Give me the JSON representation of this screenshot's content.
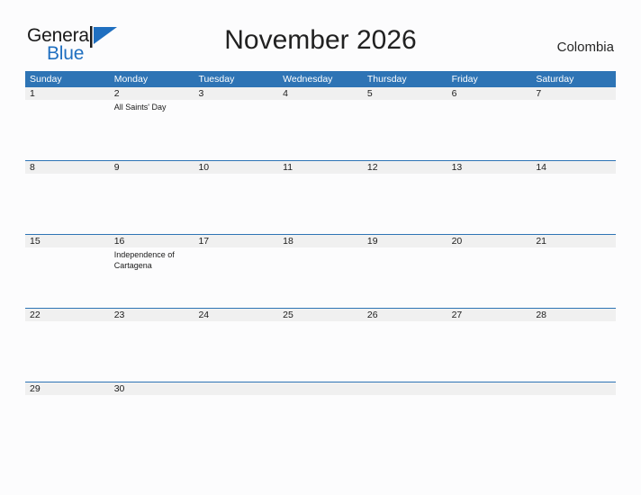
{
  "brand": {
    "name_part1": "General",
    "name_part2": "Blue",
    "flag_icon": "flag-triangle-icon",
    "blue": "#1f6fc0"
  },
  "header": {
    "title": "November 2026",
    "country": "Colombia"
  },
  "calendar": {
    "accent_color": "#2e74b5",
    "band_color": "#f0f0f0",
    "weekday_headers": [
      "Sunday",
      "Monday",
      "Tuesday",
      "Wednesday",
      "Thursday",
      "Friday",
      "Saturday"
    ],
    "weeks": [
      {
        "days": [
          {
            "date": "1",
            "events": []
          },
          {
            "date": "2",
            "events": [
              "All Saints' Day"
            ]
          },
          {
            "date": "3",
            "events": []
          },
          {
            "date": "4",
            "events": []
          },
          {
            "date": "5",
            "events": []
          },
          {
            "date": "6",
            "events": []
          },
          {
            "date": "7",
            "events": []
          }
        ]
      },
      {
        "days": [
          {
            "date": "8",
            "events": []
          },
          {
            "date": "9",
            "events": []
          },
          {
            "date": "10",
            "events": []
          },
          {
            "date": "11",
            "events": []
          },
          {
            "date": "12",
            "events": []
          },
          {
            "date": "13",
            "events": []
          },
          {
            "date": "14",
            "events": []
          }
        ]
      },
      {
        "days": [
          {
            "date": "15",
            "events": []
          },
          {
            "date": "16",
            "events": [
              "Independence of Cartagena"
            ]
          },
          {
            "date": "17",
            "events": []
          },
          {
            "date": "18",
            "events": []
          },
          {
            "date": "19",
            "events": []
          },
          {
            "date": "20",
            "events": []
          },
          {
            "date": "21",
            "events": []
          }
        ]
      },
      {
        "days": [
          {
            "date": "22",
            "events": []
          },
          {
            "date": "23",
            "events": []
          },
          {
            "date": "24",
            "events": []
          },
          {
            "date": "25",
            "events": []
          },
          {
            "date": "26",
            "events": []
          },
          {
            "date": "27",
            "events": []
          },
          {
            "date": "28",
            "events": []
          }
        ]
      },
      {
        "days": [
          {
            "date": "29",
            "events": []
          },
          {
            "date": "30",
            "events": []
          },
          {
            "date": "",
            "events": []
          },
          {
            "date": "",
            "events": []
          },
          {
            "date": "",
            "events": []
          },
          {
            "date": "",
            "events": []
          },
          {
            "date": "",
            "events": []
          }
        ]
      }
    ]
  }
}
